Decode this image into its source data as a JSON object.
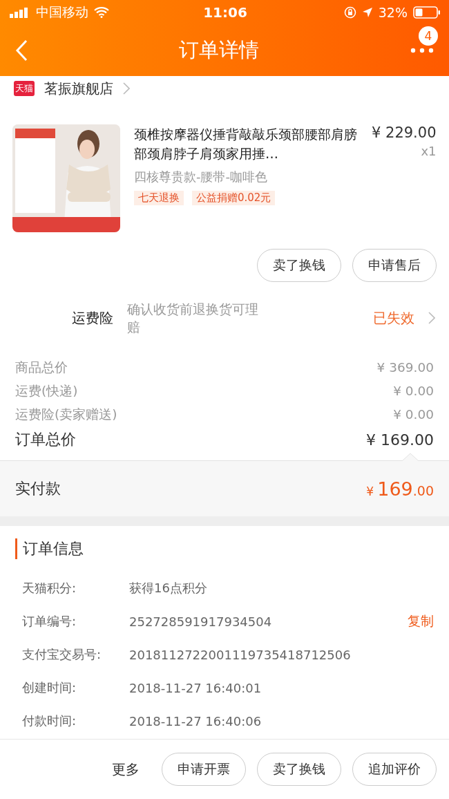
{
  "status_bar": {
    "carrier": "中国移动",
    "time": "11:06",
    "battery": "32%"
  },
  "nav": {
    "title": "订单详情",
    "badge": "4"
  },
  "shop": {
    "badge": "天猫",
    "name": "茗振旗舰店"
  },
  "product": {
    "title": "颈椎按摩器仪捶背敲敲乐颈部腰部肩膀部颈肩脖子肩颈家用捶…",
    "price": "¥ 229.00",
    "quantity": "x1",
    "variant": "四核尊贵款-腰带-咖啡色",
    "tags": [
      "七天退换",
      "公益捐赠0.02元"
    ],
    "buttons": [
      "卖了换钱",
      "申请售后"
    ]
  },
  "insurance": {
    "label": "运费险",
    "description": "确认收货前退换货可理赔",
    "status": "已失效"
  },
  "costs": [
    {
      "label": "商品总价",
      "value": "¥ 369.00"
    },
    {
      "label": "运费(快递)",
      "value": "¥ 0.00"
    },
    {
      "label": "运费险(卖家赠送)",
      "value": "¥ 0.00"
    }
  ],
  "order_total": {
    "label": "订单总价",
    "value": "¥ 169.00"
  },
  "paid": {
    "label": "实付款",
    "currency": "¥",
    "integer": "169",
    "decimal": ".00"
  },
  "order_info": {
    "title": "订单信息",
    "rows": [
      {
        "label": "天猫积分:",
        "value": "获得16点积分"
      },
      {
        "label": "订单编号:",
        "value": "252728591917934504",
        "action": "复制"
      },
      {
        "label": "支付宝交易号:",
        "value": "2018112722001119735418712506"
      },
      {
        "label": "创建时间:",
        "value": "2018-11-27 16:40:01"
      },
      {
        "label": "付款时间:",
        "value": "2018-11-27 16:40:06"
      }
    ]
  },
  "bottom_bar": {
    "more": "更多",
    "buttons": [
      "申请开票",
      "卖了换钱",
      "追加评价"
    ]
  }
}
